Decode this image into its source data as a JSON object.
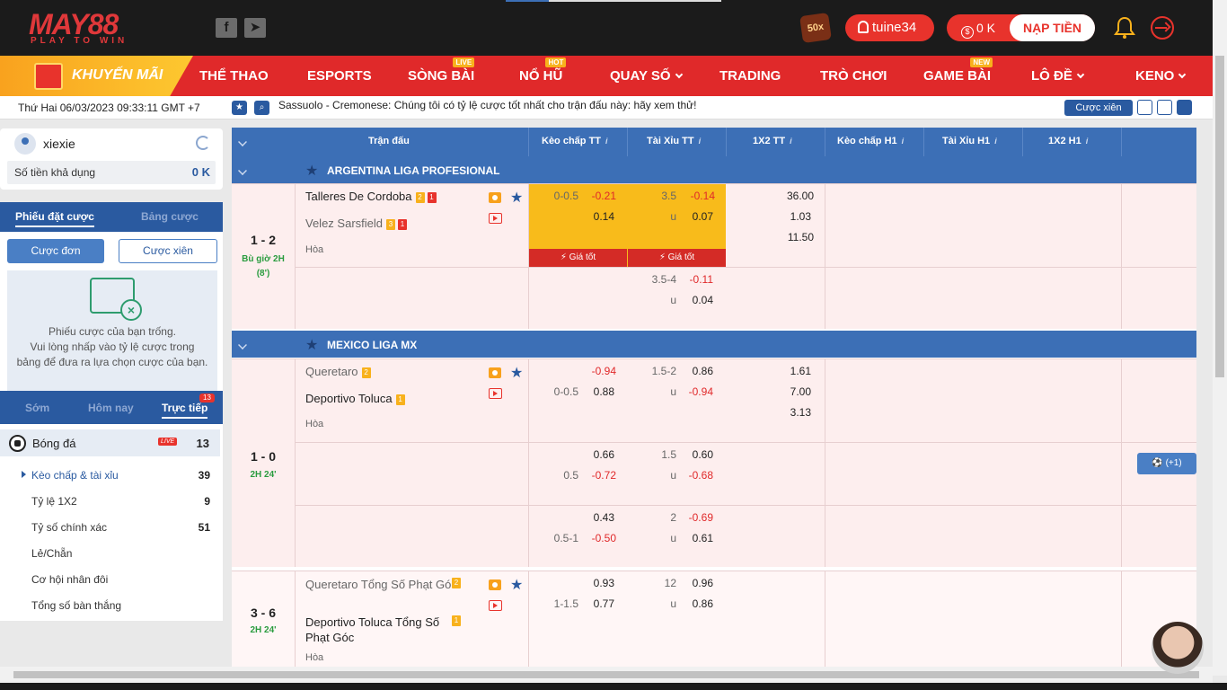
{
  "header": {
    "logo_main": "MAY88",
    "logo_sub": "PLAY TO WIN",
    "promo_badge": "50x",
    "username": "tuine34",
    "balance": "0 K",
    "deposit_label": "NẠP TIỀN"
  },
  "nav": {
    "promo_label": "KHUYẾN MÃI",
    "items": [
      {
        "label": "THỂ THAO",
        "tag": ""
      },
      {
        "label": "ESPORTS",
        "tag": ""
      },
      {
        "label": "SÒNG BÀI",
        "tag": "LIVE"
      },
      {
        "label": "NỔ HŨ",
        "tag": "HOT"
      },
      {
        "label": "QUAY SỐ",
        "tag": ""
      },
      {
        "label": "TRADING",
        "tag": ""
      },
      {
        "label": "TRÒ CHƠI",
        "tag": ""
      },
      {
        "label": "GAME BÀI",
        "tag": "NEW"
      },
      {
        "label": "LÔ ĐỀ",
        "tag": ""
      },
      {
        "label": "KENO",
        "tag": ""
      }
    ]
  },
  "ticker": {
    "datetime": "Thứ Hai 06/03/2023 09:33:11 GMT +7",
    "message": "Sassuolo - Cremonese: Chúng tôi có tỷ lệ cược tốt nhất cho trận đấu này: hãy xem thử!",
    "parlay_label": "Cược xiên"
  },
  "sidebar": {
    "user": "xiexie",
    "balance_label": "Số tiền khả dụng",
    "balance_value": "0 K",
    "slip_tabs": [
      "Phiếu đặt cược",
      "Bảng cược"
    ],
    "single_label": "Cược đơn",
    "parlay_label": "Cược xiên",
    "empty_line1": "Phiếu cược của bạn trống.",
    "empty_line2": "Vui lòng nhấp vào tỷ lệ cược trong",
    "empty_line3": "bảng để đưa ra lựa chọn cược của bạn.",
    "sport_tabs": [
      "Sớm",
      "Hôm nay",
      "Trực tiếp"
    ],
    "live_count": "13",
    "sport_name": "Bóng đá",
    "live_tag": "LIVE",
    "sport_count": "13",
    "markets": [
      {
        "label": "Kèo chấp & tài xỉu",
        "count": "39"
      },
      {
        "label": "Tỷ lệ 1X2",
        "count": "9"
      },
      {
        "label": "Tỷ số chính xác",
        "count": "51"
      },
      {
        "label": "Lẻ/Chẵn",
        "count": ""
      },
      {
        "label": "Cơ hội nhân đôi",
        "count": ""
      },
      {
        "label": "Tổng số bàn thắng",
        "count": ""
      }
    ]
  },
  "table": {
    "headers": [
      "Trận đấu",
      "Kèo chấp TT",
      "Tài Xỉu TT",
      "1X2 TT",
      "Kèo chấp H1",
      "Tài Xỉu H1",
      "1X2 H1"
    ],
    "best_price_label": "Giá tốt",
    "leagues": [
      {
        "name": "ARGENTINA LIGA PROFESIONAL"
      },
      {
        "name": "MEXICO LIGA MX"
      }
    ],
    "m1": {
      "score": "1 - 2",
      "status1": "Bù giờ 2H",
      "status2": "(8')",
      "home": "Talleres De Cordoba",
      "home_yc": "2",
      "home_rc": "1",
      "away": "Velez Sarsfield",
      "away_yc": "3",
      "away_rc": "1",
      "draw": "Hòa",
      "hdp_line": "0-0.5",
      "hdp_home": "-0.21",
      "hdp_away": "0.14",
      "ou_line": "3.5",
      "ou_u": "u",
      "ou_over": "-0.14",
      "ou_under": "0.07",
      "x1": "36.00",
      "x2": "1.03",
      "xd": "11.50",
      "r2_ou_line": "3.5-4",
      "r2_ou_over": "-0.11",
      "r2_ou_u": "u",
      "r2_ou_under": "0.04"
    },
    "m2": {
      "score": "1 - 0",
      "status1": "2H 24'",
      "home": "Queretaro",
      "home_yc": "2",
      "away": "Deportivo Toluca",
      "away_yc": "1",
      "draw": "Hòa",
      "hdp_home": "-0.94",
      "hdp_line": "0-0.5",
      "hdp_away": "0.88",
      "ou_line": "1.5-2",
      "ou_over": "0.86",
      "ou_u": "u",
      "ou_under": "-0.94",
      "x1": "1.61",
      "x2": "7.00",
      "xd": "3.13",
      "r2_hdp_home": "0.66",
      "r2_hdp_line": "0.5",
      "r2_hdp_away": "-0.72",
      "r2_ou_line": "1.5",
      "r2_ou_over": "0.60",
      "r2_ou_u": "u",
      "r2_ou_under": "-0.68",
      "r3_hdp_home": "0.43",
      "r3_hdp_line": "0.5-1",
      "r3_hdp_away": "-0.50",
      "r3_ou_line": "2",
      "r3_ou_over": "-0.69",
      "r3_ou_u": "u",
      "r3_ou_under": "0.61",
      "more": "(+1)"
    },
    "m3": {
      "score": "3 - 6",
      "status1": "2H 24'",
      "home": "Queretaro Tổng Số Phạt Góc",
      "home_yc": "2",
      "away": "Deportivo Toluca Tổng Số Phạt Góc",
      "away_yc": "1",
      "draw": "Hòa",
      "hdp_home": "0.93",
      "hdp_line": "1-1.5",
      "hdp_away": "0.77",
      "ou_line": "12",
      "ou_over": "0.96",
      "ou_u": "u",
      "ou_under": "0.86"
    }
  },
  "colors": {
    "brand_red": "#e0292a",
    "brand_blue": "#3c6fb6",
    "highlight": "#f8bb1b",
    "row_bg": "#fdeeee"
  }
}
